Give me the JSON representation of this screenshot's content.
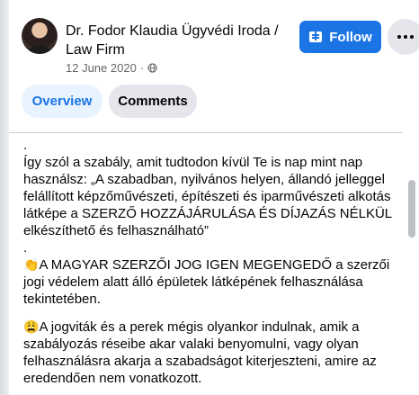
{
  "post": {
    "author": "Dr. Fodor Klaudia Ügyvédi Iroda / Law Firm",
    "date": "12 June 2020",
    "separator": "·",
    "privacy_icon": "globe-icon",
    "avatar_icon": "profile-photo"
  },
  "actions": {
    "follow_label": "Follow",
    "follow_icon": "follow-plus-icon",
    "more_icon": "more-dots-icon"
  },
  "tabs": [
    {
      "label": "Overview",
      "active": true
    },
    {
      "label": "Comments",
      "active": false
    }
  ],
  "body": {
    "dot1": ".",
    "p1": "Így szól a szabály, amit tudtodon kívül Te is nap mint nap használsz: „A szabadban, nyilvános helyen, állandó jelleggel felállított képzőművészeti, építészeti és iparművészeti alkotás látképe a SZERZŐ HOZZÁJÁRULÁSA ÉS DÍJAZÁS NÉLKÜL elkészíthető és felhasználható”",
    "dot2": ".",
    "emoji1": "👏",
    "p2": "A MAGYAR SZERZŐI JOG IGEN MEGENGEDŐ a szerzői jogi védelem alatt álló épületek látképének felhasználása tekintetében.",
    "emoji2": "😩",
    "p3": "A jogviták és a perek mégis olyankor indulnak, amik a szabályozás réseibe akar valaki benyomulni, vagy olyan felhasználásra akarja a szabadságot kiterjeszteni, amire az eredendően nem vonatkozott."
  },
  "colors": {
    "accent": "#1b74e4",
    "tab_active_bg": "#e7f3ff",
    "tab_bg": "#e4e6eb",
    "meta_text": "#65676b"
  }
}
